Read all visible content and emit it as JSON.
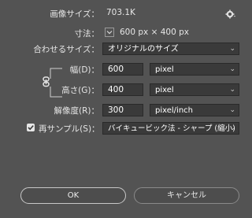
{
  "image_size": {
    "label": "画像サイズ：",
    "value": "703.1K"
  },
  "dimensions": {
    "label": "寸法：",
    "value": "600 px × 400 px"
  },
  "fit_to": {
    "label": "合わせるサイズ：",
    "selected": "オリジナルのサイズ"
  },
  "width": {
    "label": "幅(D)：",
    "value": "600",
    "unit": "pixel"
  },
  "height": {
    "label": "高さ(G)：",
    "value": "400",
    "unit": "pixel"
  },
  "resolution": {
    "label": "解像度(R)：",
    "value": "300",
    "unit": "pixel/inch"
  },
  "resample": {
    "label": "再サンプル(S)：",
    "checked": true,
    "method": "バイキュービック法 - シャープ (縮小)"
  },
  "buttons": {
    "ok": "OK",
    "cancel": "キャンセル"
  },
  "icons": {
    "settings": "gear-icon",
    "dimensions_toggle": "chevron-down-icon",
    "constrain": "link-icon"
  },
  "colors": {
    "background": "#535353",
    "field": "#3a3a3a",
    "text": "#e6e6e6"
  }
}
